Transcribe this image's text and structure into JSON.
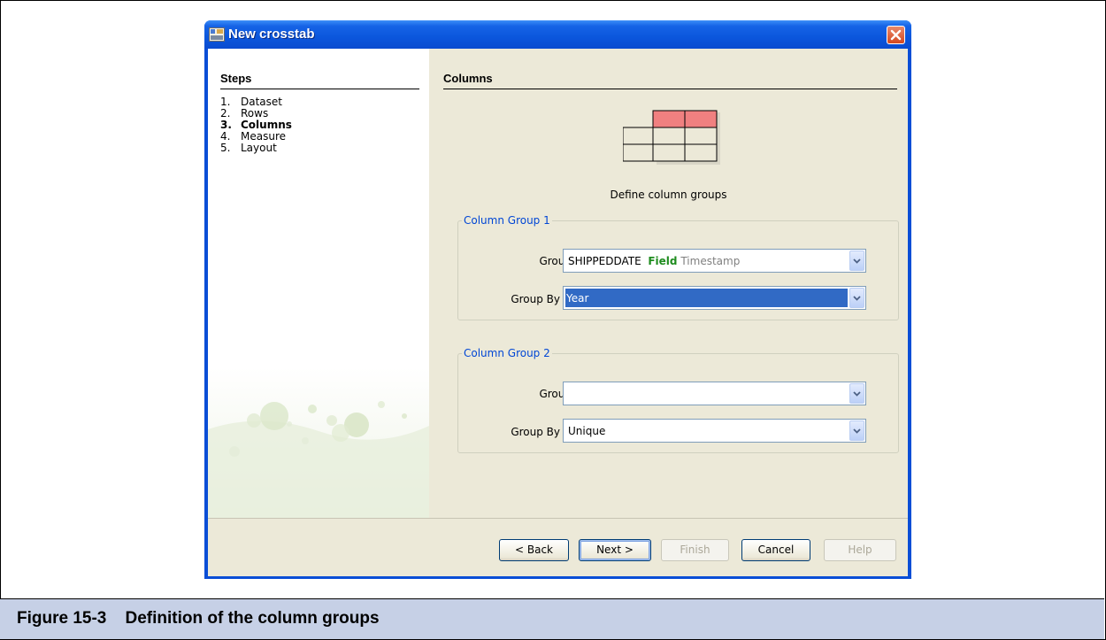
{
  "window": {
    "title": "New crosstab"
  },
  "steps_panel": {
    "heading": "Steps",
    "items": [
      {
        "num": "1.",
        "label": "Dataset"
      },
      {
        "num": "2.",
        "label": "Rows"
      },
      {
        "num": "3.",
        "label": "Columns"
      },
      {
        "num": "4.",
        "label": "Measure"
      },
      {
        "num": "5.",
        "label": "Layout"
      }
    ],
    "current_index": 2
  },
  "main": {
    "heading": "Columns",
    "description": "Define column groups",
    "column_group_1": {
      "legend": "Column Group 1",
      "group_label": "Group",
      "group_value_field": "SHIPPEDDATE",
      "group_value_kind": "Field",
      "group_value_type": "Timestamp",
      "group_by_label": "Group By",
      "group_by_value": "Year"
    },
    "column_group_2": {
      "legend": "Column Group 2",
      "group_label": "Group",
      "group_value": "",
      "group_by_label": "Group By",
      "group_by_value": "Unique"
    }
  },
  "buttons": {
    "back": "< Back",
    "next": "Next >",
    "finish": "Finish",
    "cancel": "Cancel",
    "help": "Help"
  },
  "caption": "Figure 15-3    Definition of the column groups",
  "colors": {
    "title_bar": "#0a4ed6",
    "selection": "#316ac5",
    "field_tag": "#1e8c1e",
    "highlight_cells": "#f08080",
    "caption_band": "#c6d0e6"
  }
}
